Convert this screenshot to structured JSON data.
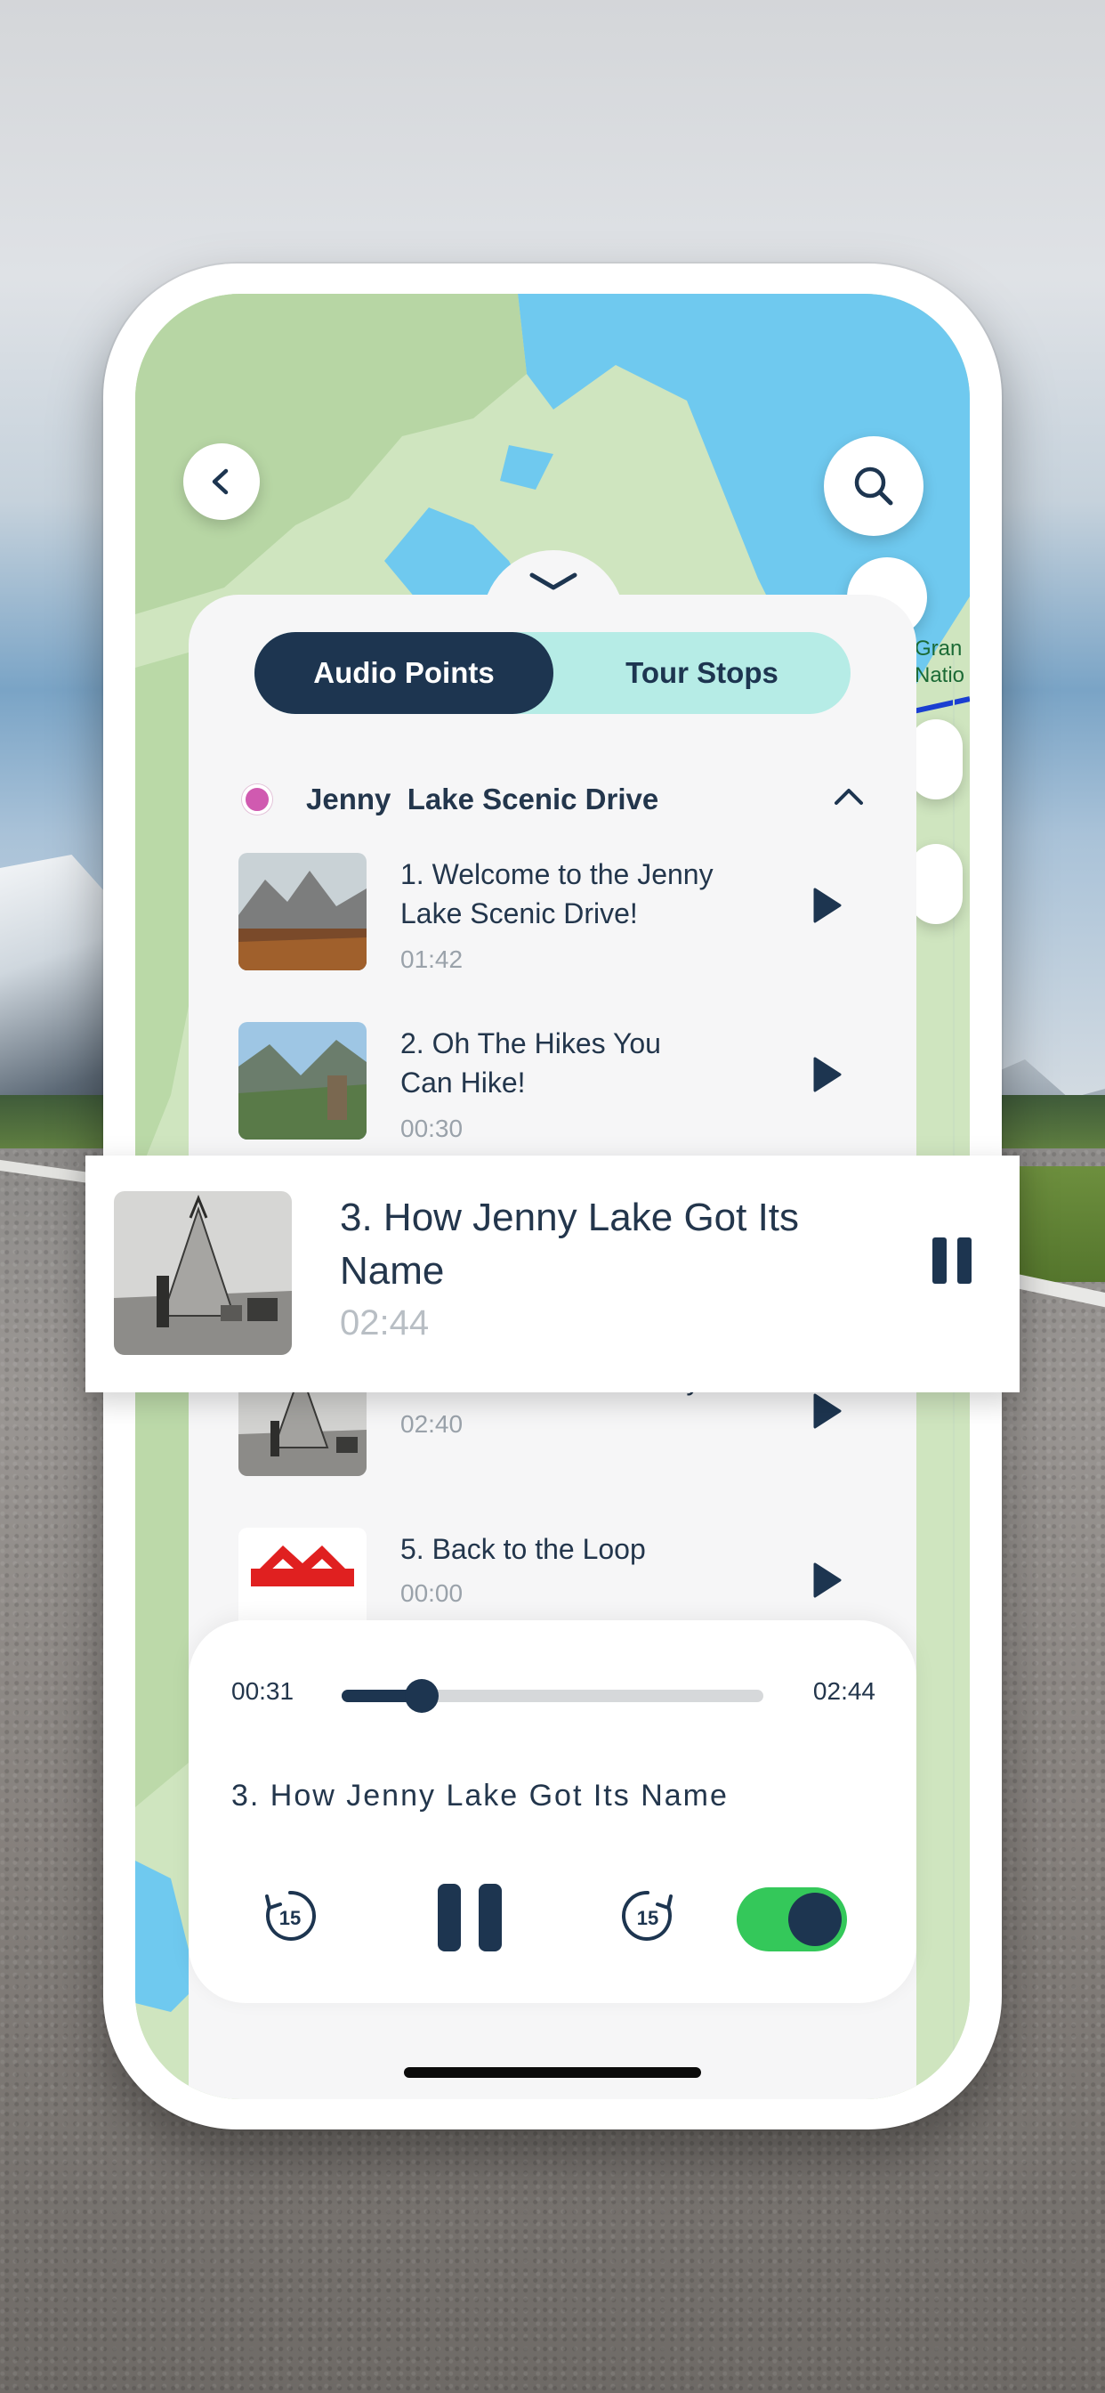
{
  "tabs": {
    "active_label": "Audio Points",
    "inactive_label": "Tour Stops"
  },
  "map": {
    "label": "Gran\nNatio"
  },
  "group": {
    "title": "Jenny  Lake Scenic Drive",
    "dot_color": "#d05ab0"
  },
  "items": [
    {
      "title": "1. Welcome to the Jenny Lake Scenic Drive!",
      "time": "01:42"
    },
    {
      "title": "2. Oh The Hikes You Can Hike!",
      "time": "00:30"
    },
    {
      "title": "4. The Rest of the Story",
      "time": "02:40"
    },
    {
      "title": "5. Back to the Loop",
      "time": "00:00"
    }
  ],
  "featured": {
    "title": "3. How Jenny Lake Got Its Name",
    "time": "02:44"
  },
  "player": {
    "elapsed": "00:31",
    "duration": "02:44",
    "progress": 0.19,
    "title": "3. How Jenny Lake Got Its Name",
    "rewind_label": "15",
    "forward_label": "15",
    "toggle_on": true
  },
  "colors": {
    "navy": "#1d3550",
    "mint": "#b6ece6",
    "toggle_green": "#34c85a",
    "map_land": "#cfe5bf",
    "map_water": "#6fc9ef"
  },
  "icons": {
    "back": "chevron-left-icon",
    "search": "search-icon",
    "collapse": "chevron-up-icon",
    "play": "play-icon",
    "pause": "pause-icon",
    "rewind": "rewind-15-icon",
    "forward": "forward-15-icon"
  }
}
